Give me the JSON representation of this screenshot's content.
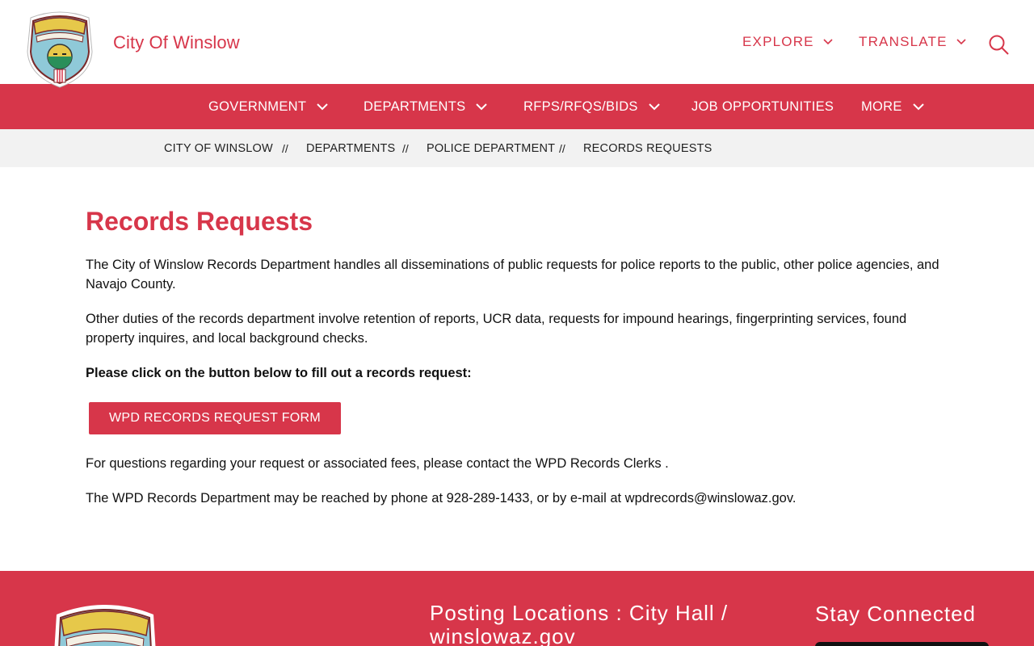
{
  "header": {
    "site_name": "City Of Winslow",
    "logo_text_top": "CITY OF WINSLOW",
    "logo_text_band": "ARIZONA",
    "utility": [
      {
        "label": "EXPLORE",
        "icon": "chevron-down-icon"
      },
      {
        "label": "TRANSLATE",
        "icon": "chevron-down-icon"
      }
    ],
    "search_icon": "search-icon"
  },
  "nav": {
    "items": [
      {
        "label": "GOVERNMENT",
        "has_dropdown": true
      },
      {
        "label": "DEPARTMENTS",
        "has_dropdown": true
      },
      {
        "label": "RFPS/RFQS/BIDS",
        "has_dropdown": true
      },
      {
        "label": "JOB OPPORTUNITIES",
        "has_dropdown": false
      },
      {
        "label": "MORE",
        "has_dropdown": true
      }
    ]
  },
  "breadcrumb": {
    "separator": "//",
    "items": [
      "CITY OF WINSLOW",
      "DEPARTMENTS",
      "POLICE DEPARTMENT",
      "RECORDS REQUESTS"
    ]
  },
  "main": {
    "title": "Records Requests",
    "paragraphs": [
      "The City of Winslow Records Department handles all disseminations of public requests for police reports to the public, other police agencies, and Navajo County.",
      "Other duties of the records department involve retention of reports, UCR data, requests for impound hearings, fingerprinting services, found property inquires, and local background checks.",
      "Please click on the button below to fill out a records request:",
      "For questions regarding your request or associated fees, please contact the WPD Records Clerks .",
      "The WPD Records Department may be reached by phone at 928-289-1433, or by e-mail at wpdrecords@winslowaz.gov."
    ],
    "cta_label": "WPD RECORDS REQUEST FORM"
  },
  "footer": {
    "posting": "Posting Locations : City Hall / winslowaz.gov",
    "stay_connected": "Stay Connected"
  },
  "colors": {
    "brand_red": "#d7364a",
    "breadcrumb_bg": "#f2f2f2",
    "text": "#111111"
  }
}
